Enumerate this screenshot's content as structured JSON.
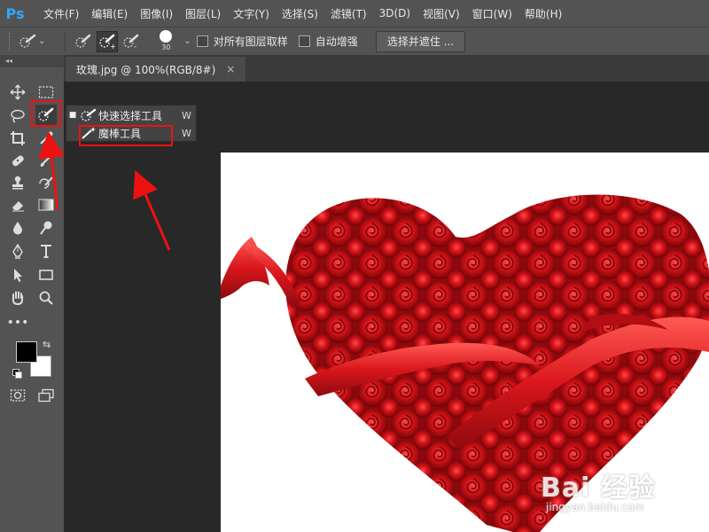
{
  "app": {
    "logo": "Ps"
  },
  "menu": [
    "文件(F)",
    "编辑(E)",
    "图像(I)",
    "图层(L)",
    "文字(Y)",
    "选择(S)",
    "滤镜(T)",
    "3D(D)",
    "视图(V)",
    "窗口(W)",
    "帮助(H)"
  ],
  "options": {
    "brush_size": "30",
    "sample_all_layers": "对所有图层取样",
    "auto_enhance": "自动增强",
    "select_and_mask": "选择并遮住 ..."
  },
  "toolbar": {
    "collapse": "◂◂"
  },
  "document": {
    "tab_title": "玫瑰.jpg @ 100%(RGB/8#)",
    "close": "×"
  },
  "flyout": {
    "items": [
      {
        "label": "快速选择工具",
        "shortcut": "W",
        "icon": "quick-selection-icon",
        "active": true
      },
      {
        "label": "魔棒工具",
        "shortcut": "W",
        "icon": "magic-wand-icon",
        "active": false
      }
    ]
  },
  "watermark": {
    "brand": "Bai 经验",
    "url": "jingyan.baidu.com"
  },
  "colors": {
    "ui": "#535353",
    "highlight": "#e11111",
    "accent": "#31a8ff",
    "rose": "#c8101a"
  }
}
